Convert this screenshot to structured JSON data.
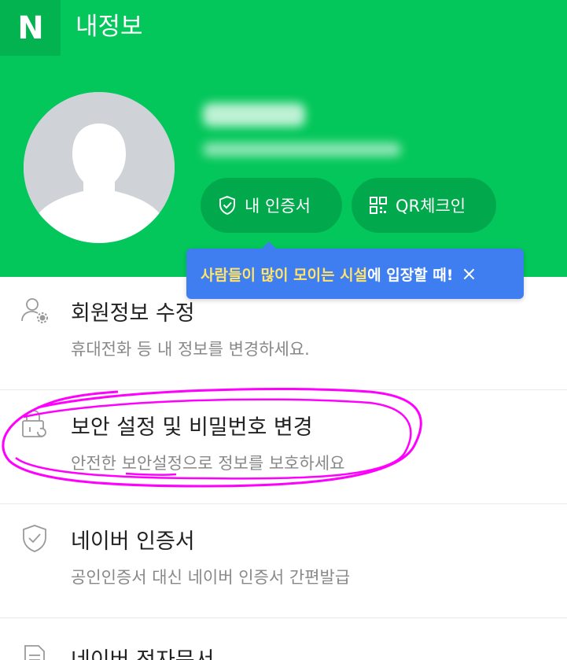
{
  "header": {
    "logo_text": "N",
    "title": "내정보",
    "brand_color": "#03c75a"
  },
  "profile": {
    "avatar": "default-person-avatar",
    "name_hidden": true,
    "email_hidden": true,
    "buttons": [
      {
        "label": "내 인증서",
        "icon": "shield-check-icon"
      },
      {
        "label": "QR체크인",
        "icon": "qr-code-icon"
      }
    ]
  },
  "tooltip": {
    "highlight": "사람들이 많이 모이는 시설",
    "rest": "에 입장할 때!",
    "close": "×",
    "color": "#3e7ef1"
  },
  "menu": [
    {
      "title": "회원정보 수정",
      "description": "휴대전화 등 내 정보를 변경하세요.",
      "icon": "user-settings-icon"
    },
    {
      "title": "보안 설정 및 비밀번호 변경",
      "description": "안전한 보안설정으로 정보를 보호하세요",
      "icon": "lock-refresh-icon"
    },
    {
      "title": "네이버 인증서",
      "description": "공인인증서 대신 네이버 인증서 간편발급",
      "icon": "shield-check-icon"
    },
    {
      "title": "네이버 전자문서",
      "description": "",
      "icon": "document-icon"
    }
  ],
  "annotation": {
    "color": "#ff00ff",
    "shape": "hand-drawn-ellipse"
  }
}
